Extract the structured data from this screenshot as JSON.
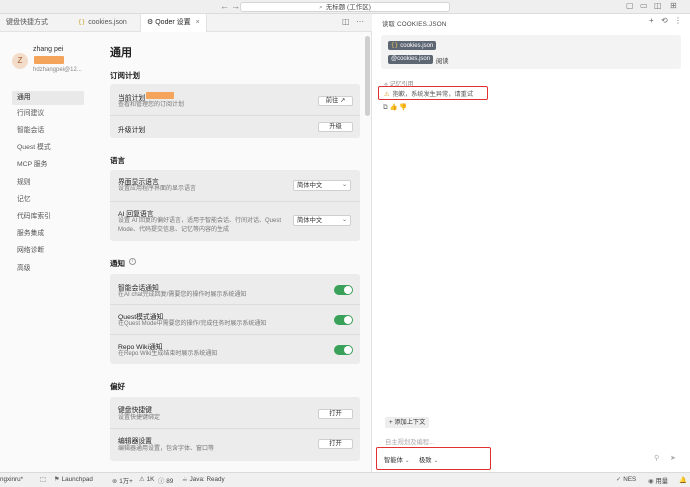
{
  "window": {
    "title": "无标题 (工作区)"
  },
  "tabs": [
    {
      "label": "键盘快捷方式"
    },
    {
      "label": "cookies.json"
    },
    {
      "label": "Qoder 设置"
    }
  ],
  "user": {
    "avatar_letter": "Z",
    "name": "zhang pei",
    "email": "hdzhangpei@12..."
  },
  "nav": [
    {
      "label": "通用"
    },
    {
      "label": "行间建议"
    },
    {
      "label": "智能会话"
    },
    {
      "label": "Quest 模式"
    },
    {
      "label": "MCP 服务"
    },
    {
      "label": "规则"
    },
    {
      "label": "记忆"
    },
    {
      "label": "代码库索引"
    },
    {
      "label": "服务集成"
    },
    {
      "label": "网络诊断"
    },
    {
      "label": "高级"
    }
  ],
  "page": {
    "title": "通用"
  },
  "plan": {
    "heading": "订阅计划",
    "current_title": "当前计划",
    "current_desc": "查看和管理您的订阅计划",
    "goto_btn": "前往",
    "upgrade_title": "升级计划",
    "upgrade_btn": "升级"
  },
  "language": {
    "heading": "语言",
    "ui_title": "界面显示语言",
    "ui_desc": "设置应用程序界面的显示语言",
    "ui_value": "简体中文",
    "ai_title": "AI 回复语言",
    "ai_desc": "设置 AI 回复的偏好语言，适用于智能会话、行间对话、Quest Mode、代码提交信息、记忆等内容的生成",
    "ai_value": "简体中文"
  },
  "notify": {
    "heading": "通知",
    "items": [
      {
        "title": "智能会话通知",
        "desc": "在AI chat完成回复/需要您的操作时展示系统通知",
        "enabled": true
      },
      {
        "title": "Quest模式通知",
        "desc": "在Quest Mode中需要您的操作/完成任务时展示系统通知",
        "enabled": true
      },
      {
        "title": "Repo Wiki通知",
        "desc": "在Repo Wiki生成结束时展示系统通知",
        "enabled": true
      }
    ]
  },
  "prefs": {
    "heading": "偏好",
    "keybind_title": "键盘快捷键",
    "keybind_desc": "设置快捷键绑定",
    "keybind_btn": "打开",
    "editor_title": "编辑器设置",
    "editor_desc": "编辑器通用设置，包含字体、窗口等",
    "editor_btn": "打开"
  },
  "chat": {
    "title": "读取 COOKIES.JSON",
    "file_chip": "cookies.json",
    "mention_chip": "@cookies.json",
    "message_suffix": "阅读",
    "memory_label": "记忆引用",
    "error_text": "抱歉，系统发生异常，请重试",
    "add_context": "添加上下文",
    "input_placeholder": "自主规划及编程...",
    "mode": "智能体",
    "model": "极致"
  },
  "status": {
    "left_text": "ngxinru*",
    "launchpad": "Launchpad",
    "stats": "1万+",
    "count_1k": "1K",
    "count_89": "89",
    "java": "Java: Ready",
    "nes": "NES",
    "usage": "用量"
  },
  "colors": {
    "accent_green": "#3aa15a",
    "error_red": "#e03131",
    "badge_orange": "#f5a45c"
  }
}
